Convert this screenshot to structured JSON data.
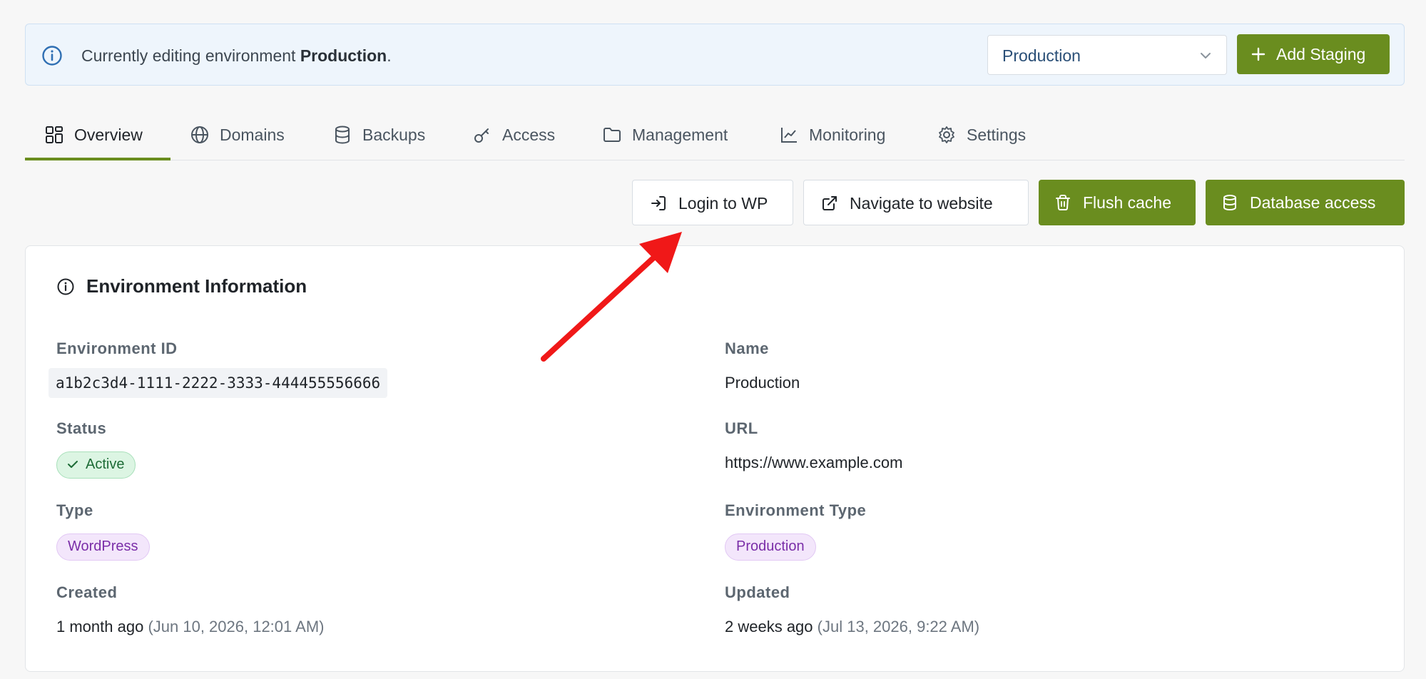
{
  "banner": {
    "prefix": "Currently editing environment ",
    "env_name": "Production",
    "suffix": "."
  },
  "env_select": {
    "value": "Production"
  },
  "add_staging": {
    "label": "Add Staging"
  },
  "tabs": [
    {
      "label": "Overview",
      "icon": "dashboard-grid-icon",
      "active": true
    },
    {
      "label": "Domains",
      "icon": "globe-icon",
      "active": false
    },
    {
      "label": "Backups",
      "icon": "database-icon",
      "active": false
    },
    {
      "label": "Access",
      "icon": "key-icon",
      "active": false
    },
    {
      "label": "Management",
      "icon": "folder-icon",
      "active": false
    },
    {
      "label": "Monitoring",
      "icon": "line-chart-icon",
      "active": false
    },
    {
      "label": "Settings",
      "icon": "gear-icon",
      "active": false
    }
  ],
  "actions": {
    "login": "Login to WP",
    "navigate": "Navigate to website",
    "flush": "Flush cache",
    "database": "Database access"
  },
  "card": {
    "title": "Environment Information",
    "env_id_label": "Environment ID",
    "env_id": "a1b2c3d4-1111-2222-3333-444455556666",
    "name_label": "Name",
    "name": "Production",
    "status_label": "Status",
    "status": "Active",
    "url_label": "URL",
    "url": "https://www.example.com",
    "type_label": "Type",
    "type": "WordPress",
    "env_type_label": "Environment Type",
    "env_type": "Production",
    "created_label": "Created",
    "created_relative": "1 month ago",
    "created_exact": "(Jun 10, 2026, 12:01 AM)",
    "updated_label": "Updated",
    "updated_relative": "2 weeks ago",
    "updated_exact": "(Jul 13, 2026, 9:22 AM)"
  },
  "colors": {
    "accent_green": "#6a8d1f",
    "annotation_arrow": "#f01818",
    "banner_bg": "#eef5fc"
  }
}
